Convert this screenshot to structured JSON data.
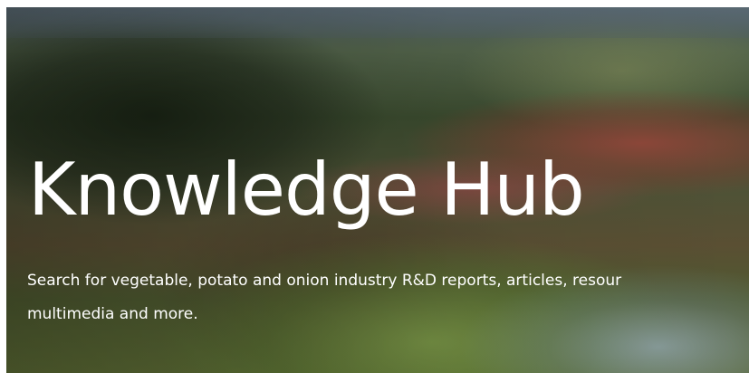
{
  "hero": {
    "title": "Knowledge Hub",
    "subtitle_line1": "Search for vegetable, potato and onion industry R&D reports, articles, resour",
    "subtitle_line2": "multimedia and more.",
    "background_description_colors": {
      "text": "#ffffff"
    }
  }
}
